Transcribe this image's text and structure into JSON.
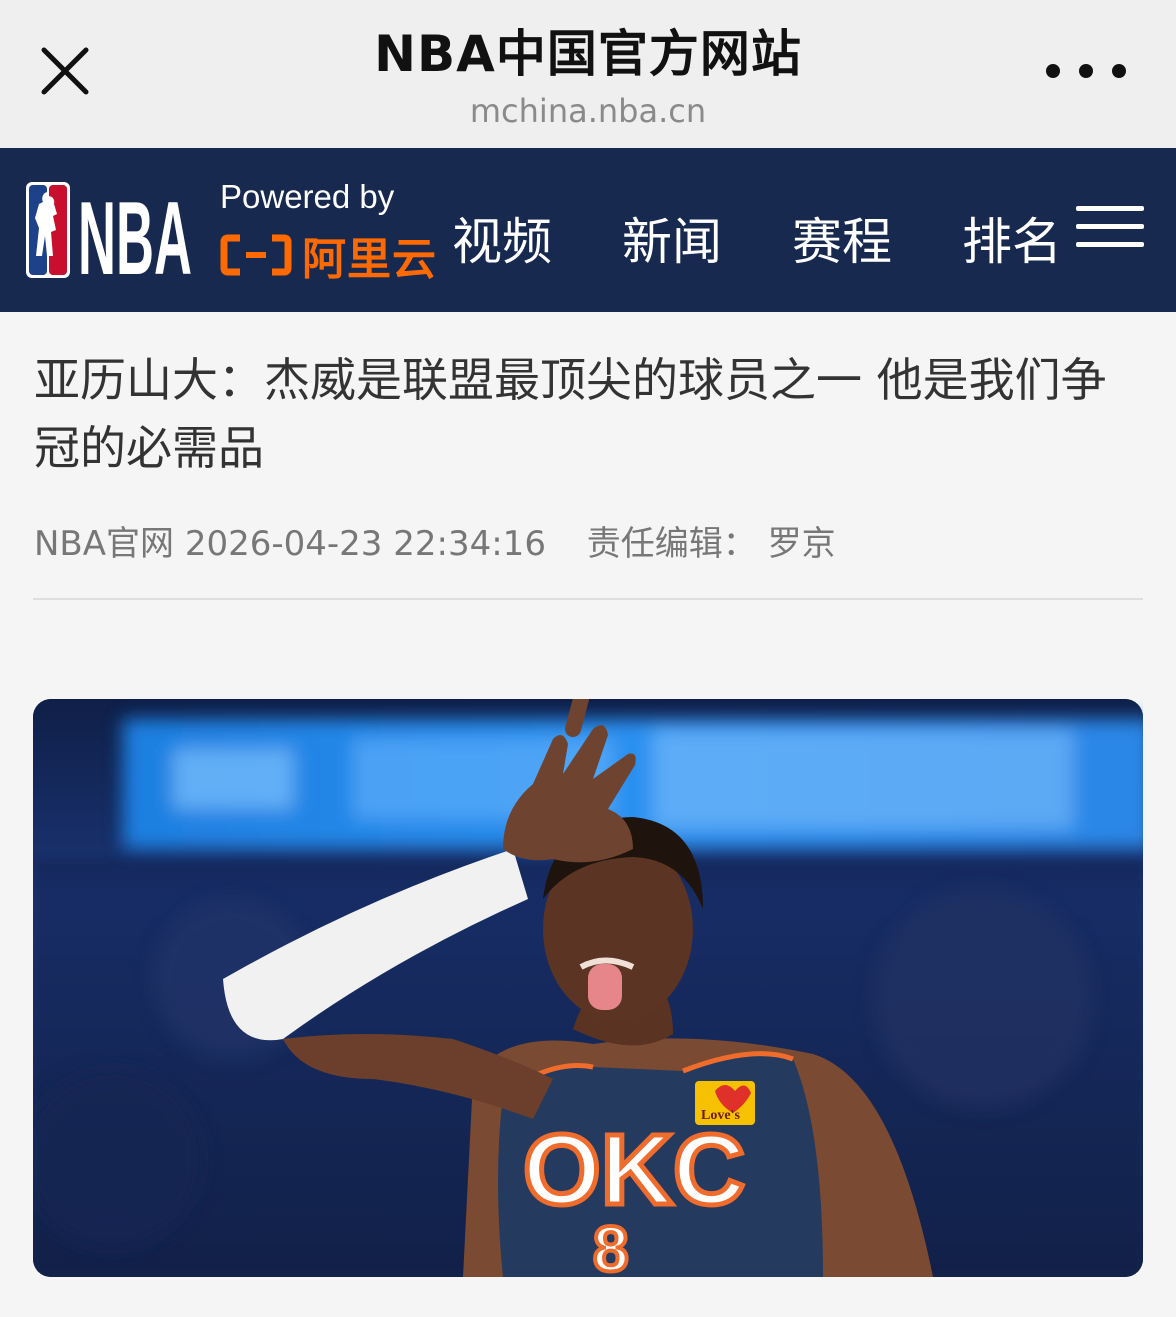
{
  "browser": {
    "title": "NBA中国官方网站",
    "url": "mchina.nba.cn",
    "close_icon": "close-icon",
    "more_icon": "more-dots-icon"
  },
  "nav": {
    "logo_text": "NBA",
    "powered_by": "Powered by",
    "partner_name": "阿里云",
    "items": [
      {
        "label": "视频"
      },
      {
        "label": "新闻"
      },
      {
        "label": "赛程"
      },
      {
        "label": "排名"
      }
    ],
    "menu_icon": "hamburger-menu-icon"
  },
  "article": {
    "title": "亚历山大：杰威是联盟最顶尖的球员之一 他是我们争冠的必需品",
    "source": "NBA官网",
    "datetime": "2026-04-23 22:34:16",
    "editor": "责任编辑：  罗京"
  },
  "image": {
    "jersey_text": "OKC",
    "jersey_number": "8",
    "patch_text": "Love's"
  },
  "colors": {
    "nav_background": "#17294f",
    "accent_orange": "#ff6a00",
    "topbar_background": "#efefef"
  }
}
